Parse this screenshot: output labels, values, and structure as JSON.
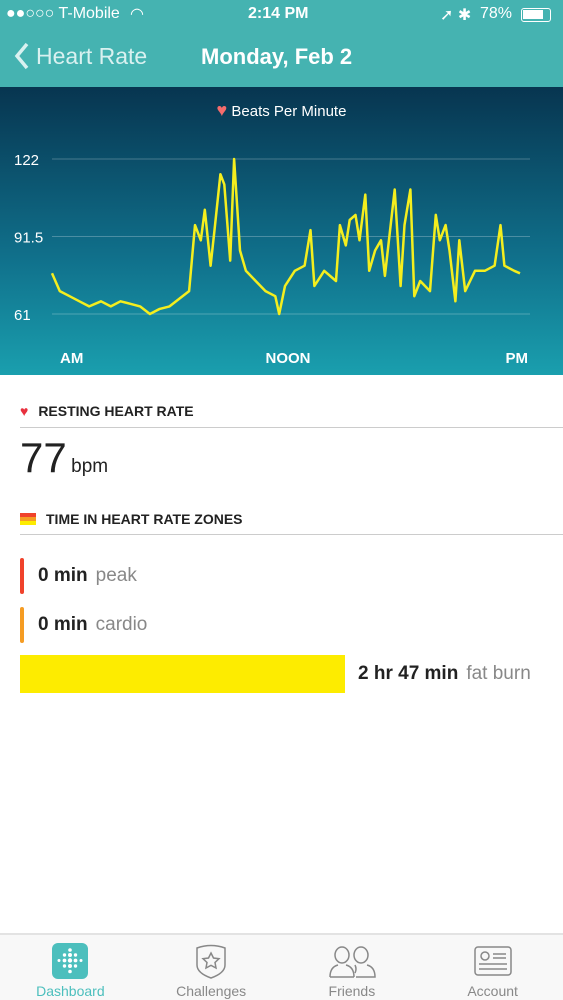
{
  "status_bar": {
    "carrier": "●●○○○ T-Mobile",
    "time": "2:14 PM",
    "battery": "78%"
  },
  "nav": {
    "back_label": "Heart Rate",
    "title": "Monday, Feb 2"
  },
  "chart_data": {
    "type": "line",
    "legend": "Beats Per Minute",
    "x_tick_labels": [
      "AM",
      "NOON",
      "PM"
    ],
    "y_ticks": [
      61,
      91.5,
      122
    ],
    "ylim": [
      61,
      122
    ],
    "xlim": [
      0,
      24
    ],
    "grid": true,
    "line_color": "#f4ee1e",
    "x": [
      0,
      0.4,
      0.9,
      1.4,
      1.9,
      2.5,
      3,
      3.5,
      4,
      4.5,
      5,
      5.5,
      6,
      6.5,
      7,
      7.3,
      7.6,
      7.8,
      8.1,
      8.3,
      8.6,
      8.8,
      9.1,
      9.3,
      9.6,
      9.9,
      10.4,
      10.9,
      11.4,
      11.6,
      11.9,
      12.4,
      12.9,
      13.2,
      13.4,
      13.9,
      14.5,
      14.7,
      15,
      15.2,
      15.5,
      15.7,
      16,
      16.2,
      16.5,
      16.8,
      17,
      17.5,
      17.8,
      18,
      18.3,
      18.5,
      18.8,
      19.3,
      19.6,
      19.8,
      20.1,
      20.3,
      20.6,
      20.8,
      21.1,
      21.6,
      22.1,
      22.6,
      22.9,
      23.1,
      23.6,
      23.9
    ],
    "y": [
      77,
      70,
      68,
      66,
      64,
      66,
      64,
      66,
      65,
      64,
      61,
      63,
      64,
      67,
      70,
      96,
      90,
      102,
      80,
      94,
      116,
      112,
      82,
      122,
      86,
      78,
      74,
      70,
      68,
      61,
      72,
      78,
      80,
      94,
      72,
      78,
      74,
      96,
      88,
      98,
      100,
      90,
      108,
      78,
      86,
      90,
      76,
      110,
      72,
      96,
      110,
      68,
      74,
      70,
      100,
      90,
      96,
      86,
      66,
      90,
      70,
      78,
      78,
      80,
      96,
      80,
      78,
      77
    ]
  },
  "resting": {
    "label": "RESTING HEART RATE",
    "value": "77",
    "unit": "bpm"
  },
  "zones": {
    "label": "TIME IN HEART RATE ZONES",
    "items": [
      {
        "value": "0 min",
        "name": "peak",
        "color": "#f0422b",
        "fraction": 0
      },
      {
        "value": "0 min",
        "name": "cardio",
        "color": "#f59c23",
        "fraction": 0
      },
      {
        "value": "2 hr 47 min",
        "name": "fat burn",
        "color": "#fdec00",
        "fraction": 1
      }
    ]
  },
  "tabs": [
    {
      "label": "Dashboard",
      "icon": "dashboard-icon",
      "active": true
    },
    {
      "label": "Challenges",
      "icon": "challenges-icon"
    },
    {
      "label": "Friends",
      "icon": "friends-icon"
    },
    {
      "label": "Account",
      "icon": "account-icon"
    }
  ]
}
